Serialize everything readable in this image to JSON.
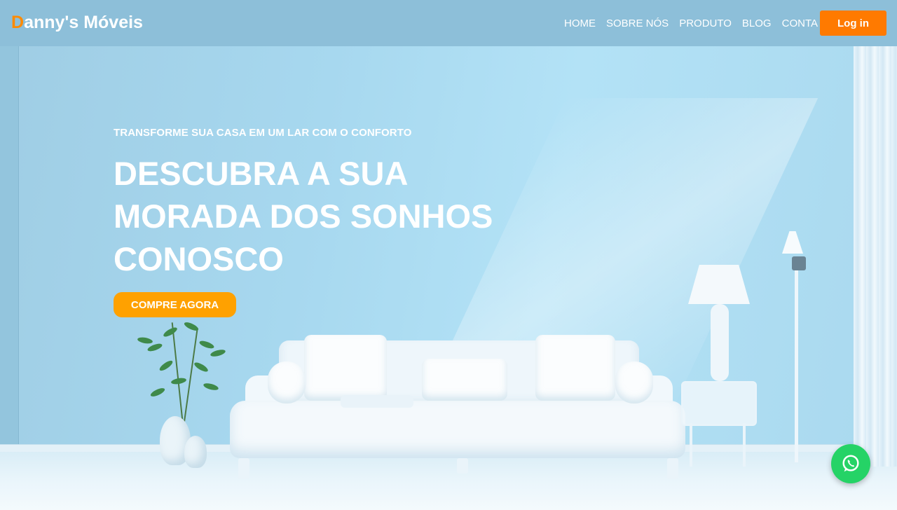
{
  "brand": {
    "initial": "D",
    "rest": "anny's Móveis"
  },
  "nav": {
    "links": [
      {
        "label": "HOME"
      },
      {
        "label": "SOBRE NÓS"
      },
      {
        "label": "PRODUTO"
      },
      {
        "label": "BLOG"
      },
      {
        "label": "CONTA"
      }
    ],
    "login_label": "Log in"
  },
  "hero": {
    "eyebrow": "TRANSFORME SUA CASA EM UM LAR COM O CONFORTO",
    "headline": "DESCUBRA A SUA MORADA DOS SONHOS CONOSCO",
    "cta_label": "COMPRE AGORA"
  },
  "floating": {
    "icon": "whatsapp-icon"
  },
  "colors": {
    "navbar": "#8dbfd9",
    "brand_accent": "#ff8a00",
    "login_button": "#ff7a00",
    "cta_button": "#ffa100",
    "whatsapp": "#25d366"
  }
}
